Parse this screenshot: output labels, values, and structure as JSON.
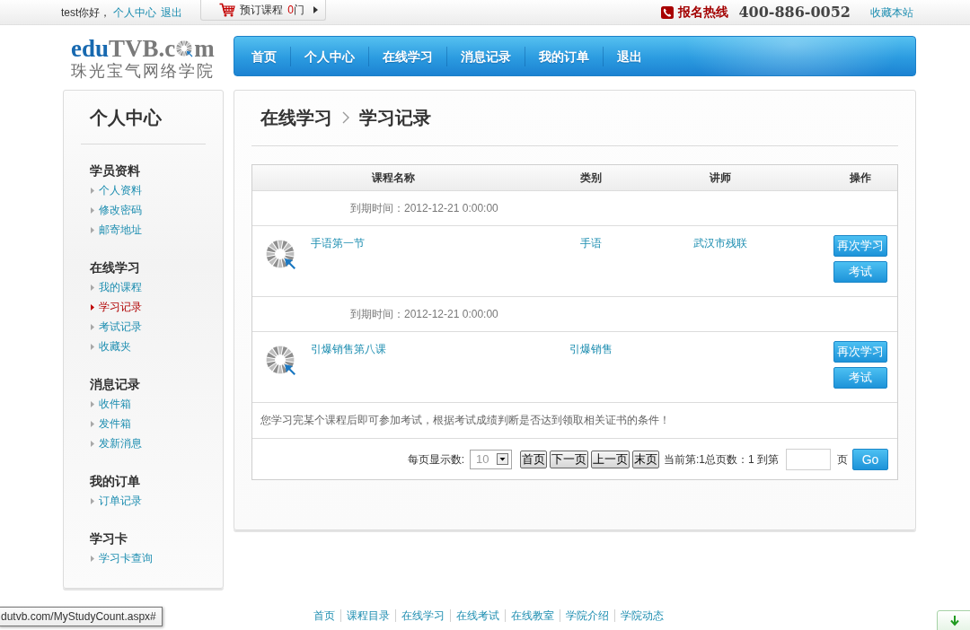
{
  "top_bar": {
    "greeting": "test你好，",
    "links": [
      "个人中心",
      "退出"
    ],
    "cart": {
      "label": "预订课程",
      "count": "0",
      "unit": "门"
    },
    "hotline_label": "报名热线",
    "hotline_number": "400-886-0052",
    "bookmark": "收藏本站"
  },
  "logo": {
    "brand_1": "edu",
    "brand_2": "TVB.c",
    "brand_3": "m",
    "subtitle": "珠光宝气网络学院"
  },
  "nav": {
    "items": [
      "首页",
      "个人中心",
      "在线学习",
      "消息记录",
      "我的订单",
      "退出"
    ]
  },
  "sidebar": {
    "title": "个人中心",
    "sections": [
      {
        "heading": "学员资料",
        "items": [
          {
            "label": "个人资料",
            "selected": false
          },
          {
            "label": "修改密码",
            "selected": false
          },
          {
            "label": "邮寄地址",
            "selected": false
          }
        ]
      },
      {
        "heading": "在线学习",
        "items": [
          {
            "label": "我的课程",
            "selected": false
          },
          {
            "label": "学习记录",
            "selected": true
          },
          {
            "label": "考试记录",
            "selected": false
          },
          {
            "label": "收藏夹",
            "selected": false
          }
        ]
      },
      {
        "heading": "消息记录",
        "items": [
          {
            "label": "收件箱",
            "selected": false
          },
          {
            "label": "发件箱",
            "selected": false
          },
          {
            "label": "发新消息",
            "selected": false
          }
        ]
      },
      {
        "heading": "我的订单",
        "items": [
          {
            "label": "订单记录",
            "selected": false
          }
        ]
      },
      {
        "heading": "学习卡",
        "items": [
          {
            "label": "学习卡查询",
            "selected": false
          }
        ]
      }
    ]
  },
  "main": {
    "breadcrumb": [
      "在线学习",
      "学习记录"
    ],
    "table": {
      "columns": [
        "课程名称",
        "类别",
        "讲师",
        "操作"
      ],
      "records": [
        {
          "expiry": "到期时间：2012-12-21 0:00:00",
          "course": "手语第一节",
          "category": "手语",
          "teacher": "武汉市残联",
          "actions": [
            "再次学习",
            "考试"
          ]
        },
        {
          "expiry": "到期时间：2012-12-21 0:00:00",
          "course": "引爆销售第八课",
          "category": "引爆销售",
          "actions": [
            "再次学习",
            "考试"
          ]
        }
      ],
      "notice": "您学习完某个课程后即可参加考试，根据考试成绩判断是否达到领取相关证书的条件！",
      "pagination": {
        "page_size_label": "每页显示数:",
        "page_size": "10",
        "buttons": [
          "首页",
          "下一页",
          "上一页",
          "末页"
        ],
        "info": "当前第:1总页数：1 到第",
        "page_unit": "页",
        "go": "Go"
      }
    }
  },
  "footer": {
    "links": [
      "首页",
      "课程目录",
      "在线学习",
      "在线考试",
      "在线教室",
      "学院介绍",
      "学院动态"
    ]
  },
  "browser_status": {
    "url": "dutvb.com/MyStudyCount.aspx#"
  }
}
